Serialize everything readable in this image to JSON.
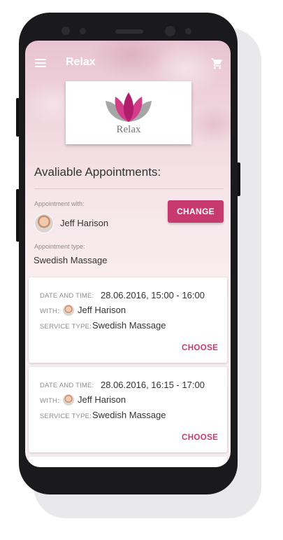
{
  "app": {
    "title": "Relax",
    "menu_icon": "hamburger-menu-icon",
    "cart_icon": "shopping-cart-icon"
  },
  "logo": {
    "text": "Relax",
    "icon": "lotus-flower-icon",
    "colors": {
      "petal_dark": "#b01e6b",
      "petal_mid": "#d23c88",
      "petal_grey": "#9b9b9b"
    }
  },
  "section": {
    "title": "Avaliable Appointments:"
  },
  "filter": {
    "with_label": "Appointment with:",
    "person_name": "Jeff Harison",
    "type_label": "Appointment type:",
    "type_value": "Swedish Massage",
    "change_button": "CHANGE"
  },
  "labels": {
    "date_time": "DATE AND TIME:",
    "with": "WITH:",
    "service_type": "SERVICE TYPE:",
    "choose": "CHOOSE"
  },
  "appointments": [
    {
      "date_time": "28.06.2016, 15:00 - 16:00",
      "with": "Jeff Harison",
      "service_type": "Swedish Massage"
    },
    {
      "date_time": "28.06.2016, 16:15 - 17:00",
      "with": "Jeff Harison",
      "service_type": "Swedish Massage"
    }
  ],
  "colors": {
    "accent": "#c73a6f",
    "text": "#333333",
    "muted": "#8e8a8c"
  }
}
